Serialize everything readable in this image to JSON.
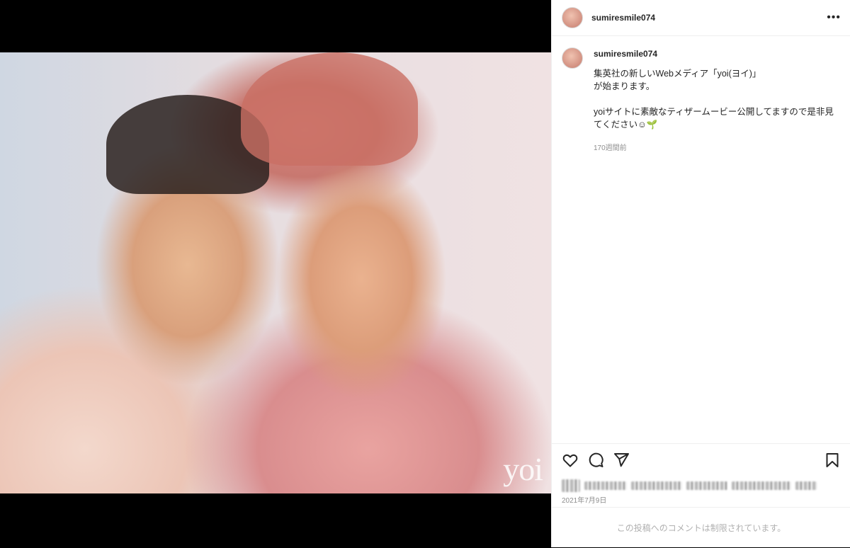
{
  "post": {
    "username": "sumiresmile074",
    "caption": "集英社の新しいWebメディア「yoi(ヨイ)」\nが始まります。\n\nyoiサイトに素敵なティザームービー公開してますので是非見てください☺🌱",
    "time_ago": "170週間前",
    "date": "2021年7月9日",
    "comments_disabled": "この投稿へのコメントは制限されています。",
    "watermark": "yoi"
  },
  "icons": {
    "more": "more-horizontal-icon",
    "like": "heart-icon",
    "comment": "comment-icon",
    "share": "send-icon",
    "save": "bookmark-icon"
  }
}
